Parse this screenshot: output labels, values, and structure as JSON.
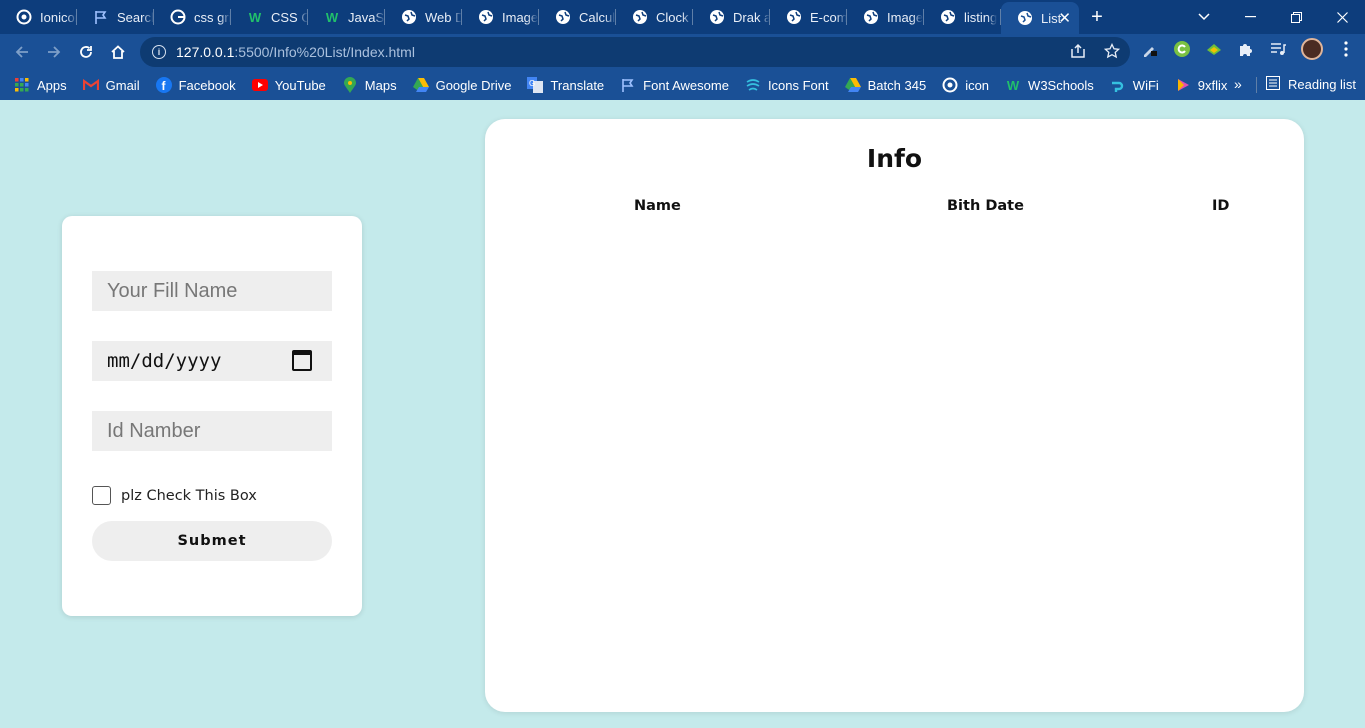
{
  "browser": {
    "tabs": [
      {
        "label": "Ionicons"
      },
      {
        "label": "Search"
      },
      {
        "label": "css grid"
      },
      {
        "label": "CSS Grid"
      },
      {
        "label": "JavaScript"
      },
      {
        "label": "Web Dev"
      },
      {
        "label": "Image"
      },
      {
        "label": "Calculator"
      },
      {
        "label": "Clock P"
      },
      {
        "label": "Drak and"
      },
      {
        "label": "E-comm"
      },
      {
        "label": "Image"
      },
      {
        "label": "listing"
      },
      {
        "label": "List"
      }
    ],
    "url_host": "127.0.0.1",
    "url_path": ":5500/Info%20List/Index.html",
    "bookmarks": [
      "Apps",
      "Gmail",
      "Facebook",
      "YouTube",
      "Maps",
      "Google Drive",
      "Translate",
      "Font Awesome",
      "Icons Font",
      "Batch 345",
      "icon",
      "W3Schools",
      "WiFi",
      "9xflix"
    ],
    "reading_list": "Reading list",
    "colors": {
      "chrome_dark": "#0d3d7c",
      "chrome": "#1a5096",
      "page_bg": "#c4eaeb"
    }
  },
  "form": {
    "name_placeholder": "Your Fill Name",
    "date_placeholder": "mm/dd/yyyy",
    "id_placeholder": "Id Namber",
    "checkbox_label": "plz Check This Box",
    "checkbox_checked": false,
    "submit_label": "Submet"
  },
  "info": {
    "title": "Info",
    "columns": {
      "name": "Name",
      "birth_date": "Bith Date",
      "id": "ID"
    },
    "rows": []
  }
}
